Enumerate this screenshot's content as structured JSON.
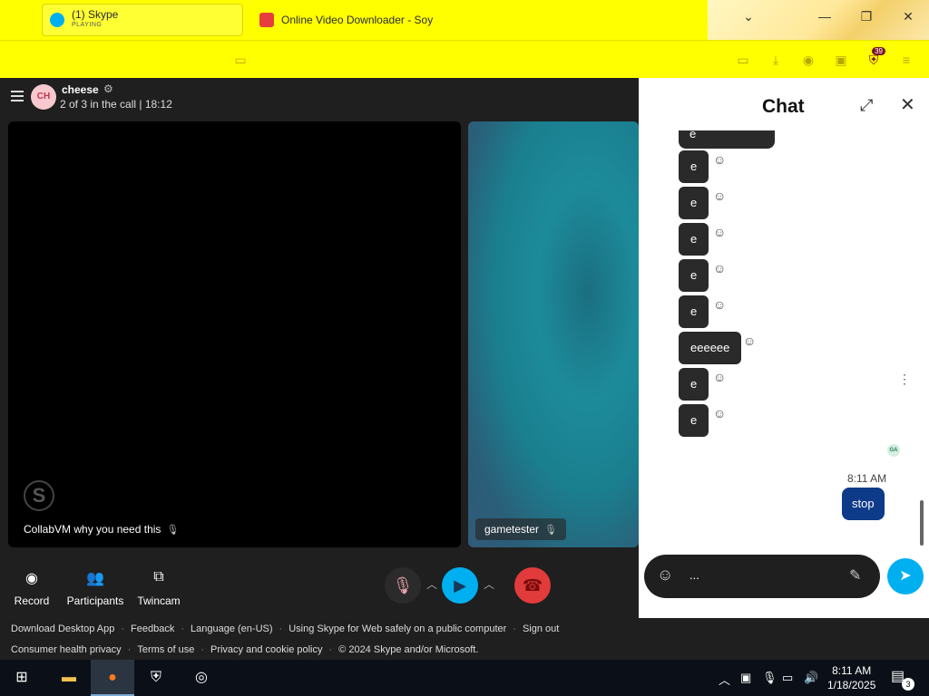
{
  "browser": {
    "tabs": [
      {
        "title": "(1) Skype",
        "subtitle": "PLAYING"
      },
      {
        "title": "Online Video Downloader - Soy"
      }
    ],
    "extension_badge": "39"
  },
  "call": {
    "avatar_initials": "CH",
    "conversation_name": "cheese",
    "status": "2 of 3 in the call | 18:12",
    "tiles": [
      {
        "label": "CollabVM why you need this"
      },
      {
        "label": "gametester"
      }
    ],
    "controls": {
      "record_label": "Record",
      "participants_label": "Participants",
      "twincam_label": "Twincam"
    }
  },
  "chat": {
    "title": "Chat",
    "messages": [
      "e",
      "e",
      "e",
      "e",
      "e",
      "e",
      "eeeeee",
      "e",
      "e"
    ],
    "seen_initials": "GA",
    "timestamp": "8:11 AM",
    "outgoing_message": "stop",
    "compose_value": "..."
  },
  "footer": {
    "row1": [
      "Download Desktop App",
      "Feedback",
      "Language (en-US)",
      "Using Skype for Web safely on a public computer",
      "Sign out"
    ],
    "row2": [
      "Consumer health privacy",
      "Terms of use",
      "Privacy and cookie policy",
      "© 2024 Skype and/or Microsoft."
    ]
  },
  "taskbar": {
    "time": "8:11 AM",
    "date": "1/18/2025",
    "notification_count": "3"
  },
  "colors": {
    "browser_chrome": "#ffff00",
    "skype_accent": "#00aff0",
    "end_call": "#e23b3b",
    "outgoing_bubble": "#0e3a8a"
  }
}
